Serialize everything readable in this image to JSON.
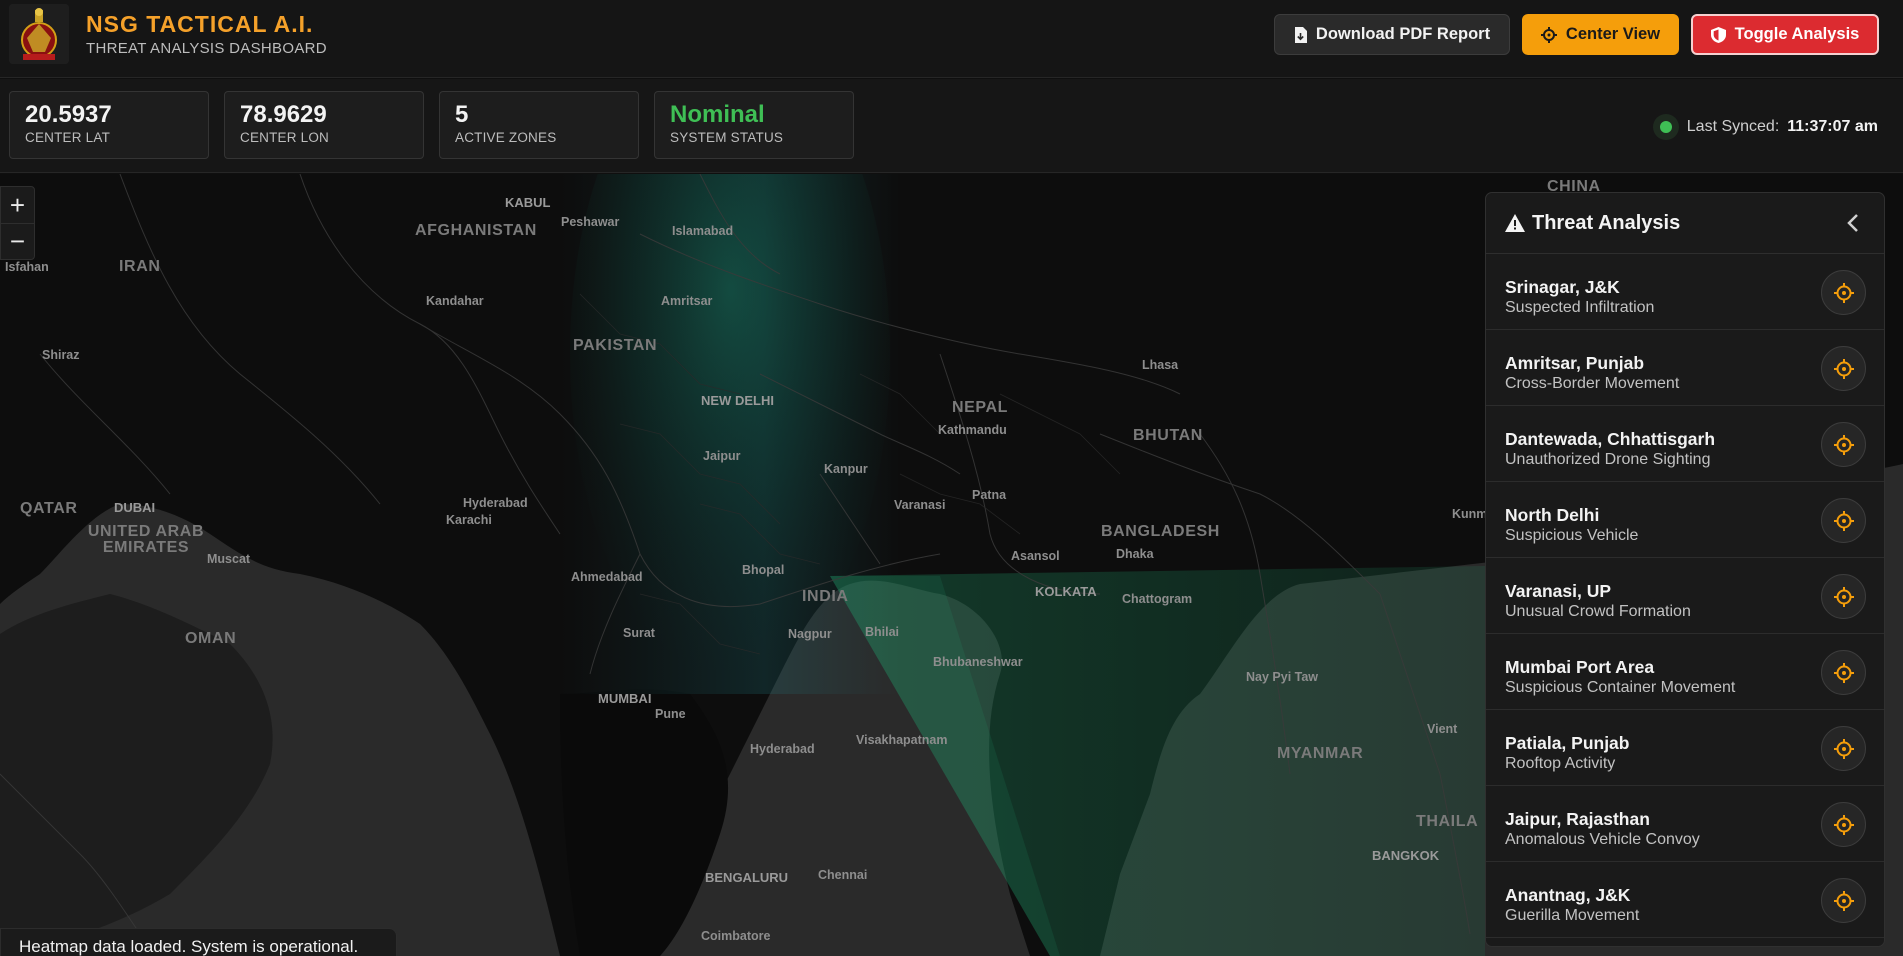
{
  "header": {
    "title": "NSG TACTICAL A.I.",
    "subtitle": "THREAT ANALYSIS DASHBOARD",
    "buttons": {
      "pdf": "Download PDF Report",
      "center": "Center View",
      "toggle": "Toggle Analysis"
    }
  },
  "stats": [
    {
      "value": "20.5937",
      "label": "CENTER LAT"
    },
    {
      "value": "78.9629",
      "label": "CENTER LON"
    },
    {
      "value": "5",
      "label": "ACTIVE ZONES"
    },
    {
      "value": "Nominal",
      "label": "SYSTEM STATUS"
    }
  ],
  "sync": {
    "label": "Last Synced:",
    "time": "11:37:07 am"
  },
  "map": {
    "labels": {
      "afghanistan": "AFGHANISTAN",
      "iran": "IRAN",
      "pakistan": "PAKISTAN",
      "oman": "OMAN",
      "india": "INDIA",
      "nepal": "NEPAL",
      "bhutan": "BHUTAN",
      "bangladesh": "BANGLADESH",
      "myanmar": "MYANMAR",
      "china": "CHINA",
      "thailand": "THAILA",
      "qatar": "QATAR",
      "uae": "UNITED ARAB EMIRATES",
      "kabul": "KABUL",
      "peshawar": "Peshawar",
      "islamabad": "Islamabad",
      "kandahar": "Kandahar",
      "amritsar": "Amritsar",
      "newdelhi": "NEW DELHI",
      "jaipur": "Jaipur",
      "kanpur": "Kanpur",
      "kathmandu": "Kathmandu",
      "lhasa": "Lhasa",
      "varanasi": "Varanasi",
      "patna": "Patna",
      "hyderabad_pk": "Hyderabad",
      "karachi": "Karachi",
      "dubai": "DUBAI",
      "muscat": "Muscat",
      "ahmedabad": "Ahmedabad",
      "bhopal": "Bhopal",
      "asansol": "Asansol",
      "dhaka": "Dhaka",
      "kolkata": "KOLKATA",
      "chattogram": "Chattogram",
      "surat": "Surat",
      "nagpur": "Nagpur",
      "bhilai": "Bhilai",
      "bhubaneshwar": "Bhubaneshwar",
      "mumbai": "MUMBAI",
      "pune": "Pune",
      "naypyitaw": "Nay Pyi Taw",
      "hyderabad_in": "Hyderabad",
      "visakhapatnam": "Visakhapatnam",
      "bengaluru": "BENGALURU",
      "chennai": "Chennai",
      "coimbatore": "Coimbatore",
      "bangkok": "BANGKOK",
      "shiraz": "Shiraz",
      "isfahan": "Isfahan",
      "kunm": "Kunm",
      "vient": "Vient"
    }
  },
  "zoom": {
    "in": "+",
    "out": "−"
  },
  "toast": "Heatmap data loaded. System is operational.",
  "panel": {
    "title": "Threat Analysis",
    "threats": [
      {
        "location": "Srinagar, J&K",
        "type": "Suspected Infiltration"
      },
      {
        "location": "Amritsar, Punjab",
        "type": "Cross-Border Movement"
      },
      {
        "location": "Dantewada, Chhattisgarh",
        "type": "Unauthorized Drone Sighting"
      },
      {
        "location": "North Delhi",
        "type": "Suspicious Vehicle"
      },
      {
        "location": "Varanasi, UP",
        "type": "Unusual Crowd Formation"
      },
      {
        "location": "Mumbai Port Area",
        "type": "Suspicious Container Movement"
      },
      {
        "location": "Patiala, Punjab",
        "type": "Rooftop Activity"
      },
      {
        "location": "Jaipur, Rajasthan",
        "type": "Anomalous Vehicle Convoy"
      },
      {
        "location": "Anantnag, J&K",
        "type": "Guerilla Movement"
      }
    ]
  },
  "colors": {
    "accent": "#f59e0b",
    "danger": "#dc2b30",
    "ok": "#3fbf55",
    "heatmap": "#1f9d6a"
  }
}
